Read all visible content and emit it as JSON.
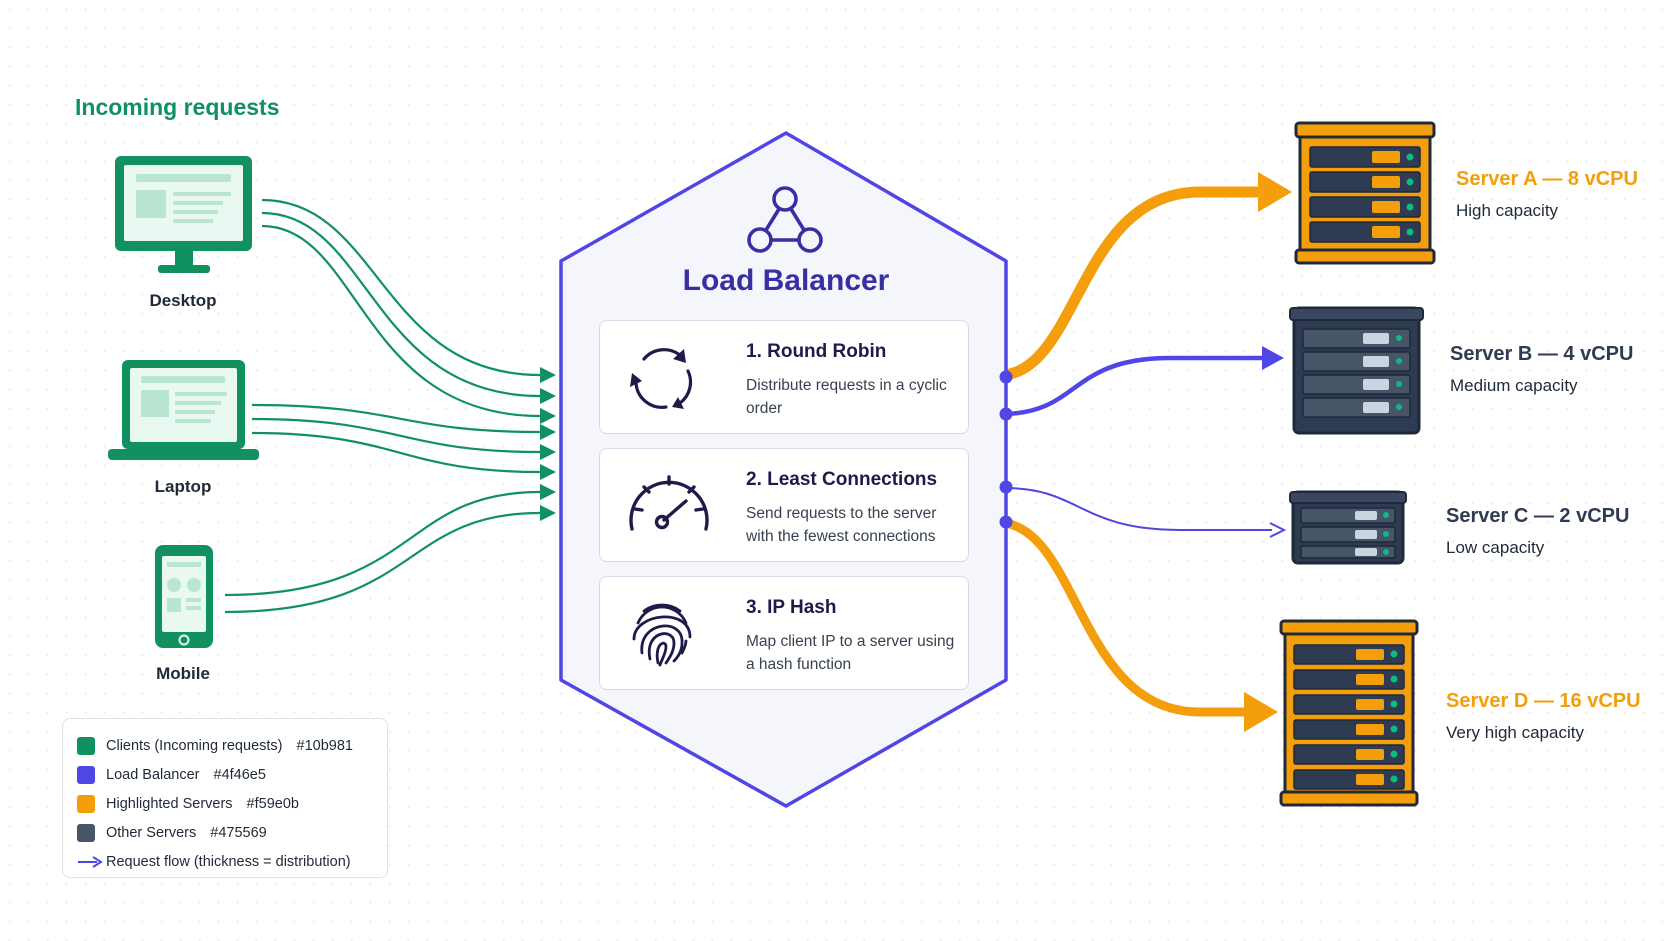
{
  "heading": "Incoming requests",
  "clients": [
    {
      "label": "Desktop"
    },
    {
      "label": "Laptop"
    },
    {
      "label": "Mobile"
    }
  ],
  "load_balancer": {
    "title": "Load Balancer",
    "algorithms": [
      {
        "title": "1. Round Robin",
        "desc": "Distribute requests in a cyclic order",
        "icon": "cycle-arrows-icon"
      },
      {
        "title": "2. Least Connections",
        "desc": "Send requests to the server with the fewest connections",
        "icon": "speedometer-icon"
      },
      {
        "title": "3. IP Hash",
        "desc": "Map client IP to a server using a hash function",
        "icon": "fingerprint-icon"
      }
    ]
  },
  "servers": [
    {
      "name": "Server A — 8 vCPU",
      "desc": "High capacity",
      "highlight": true
    },
    {
      "name": "Server B — 4 vCPU",
      "desc": "Medium capacity",
      "highlight": false
    },
    {
      "name": "Server C — 2 vCPU",
      "desc": "Low capacity",
      "highlight": false
    },
    {
      "name": "Server D — 16 vCPU",
      "desc": "Very high capacity",
      "highlight": true
    }
  ],
  "legend": {
    "items": [
      {
        "label": "Clients (Incoming requests)",
        "hex": "#10b981",
        "color": "#10915f"
      },
      {
        "label": "Load Balancer",
        "hex": "#4f46e5",
        "color": "#4f46e5"
      },
      {
        "label": "Highlighted Servers",
        "hex": "#f59e0b",
        "color": "#f59e0b"
      },
      {
        "label": "Other Servers",
        "hex": "#475569",
        "color": "#475569"
      }
    ],
    "flow_label": "Request flow (thickness = distribution)"
  },
  "colors": {
    "client": "#10915f",
    "balancer": "#4f46e5",
    "highlight": "#f59e0b",
    "other": "#475569",
    "dark_server": "#2f3b52"
  }
}
